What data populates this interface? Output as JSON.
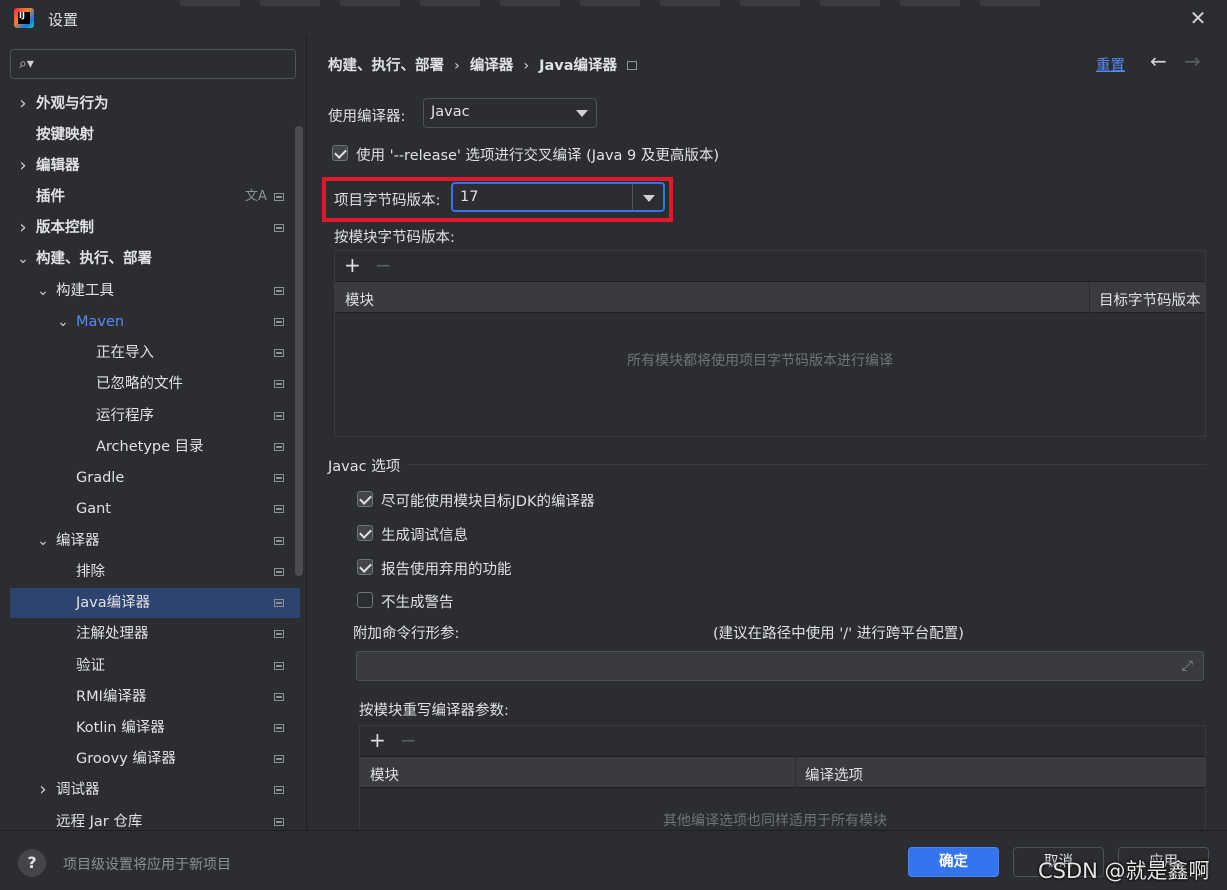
{
  "window": {
    "title": "设置",
    "app_icon_letters": "IJ",
    "close_icon": "close-icon"
  },
  "sidebar": {
    "search_placeholder": "",
    "items": [
      {
        "label": "外观与行为",
        "arrow": "›",
        "bold": true
      },
      {
        "label": "按键映射",
        "arrow": "",
        "bold": true
      },
      {
        "label": "编辑器",
        "arrow": "›",
        "bold": true
      },
      {
        "label": "插件",
        "arrow": "",
        "bold": true,
        "translate": "文A"
      },
      {
        "label": "版本控制",
        "arrow": "›",
        "bold": true
      },
      {
        "label": "构建、执行、部署",
        "arrow": "⌄",
        "bold": true
      },
      {
        "label": "构建工具",
        "arrow": "⌄"
      },
      {
        "label": "Maven",
        "arrow": "⌄"
      },
      {
        "label": "正在导入",
        "arrow": ""
      },
      {
        "label": "已忽略的文件",
        "arrow": ""
      },
      {
        "label": "运行程序",
        "arrow": ""
      },
      {
        "label": "Archetype 目录",
        "arrow": ""
      },
      {
        "label": "Gradle",
        "arrow": ""
      },
      {
        "label": "Gant",
        "arrow": ""
      },
      {
        "label": "编译器",
        "arrow": "⌄"
      },
      {
        "label": "排除",
        "arrow": ""
      },
      {
        "label": "Java编译器",
        "arrow": "",
        "selected": true
      },
      {
        "label": "注解处理器",
        "arrow": ""
      },
      {
        "label": "验证",
        "arrow": ""
      },
      {
        "label": "RMI编译器",
        "arrow": ""
      },
      {
        "label": "Kotlin 编译器",
        "arrow": ""
      },
      {
        "label": "Groovy 编译器",
        "arrow": ""
      },
      {
        "label": "调试器",
        "arrow": "›"
      },
      {
        "label": "远程 Jar 仓库",
        "arrow": ""
      }
    ]
  },
  "main": {
    "breadcrumb": [
      "构建、执行、部署",
      "编译器",
      "Java编译器"
    ],
    "breadcrumb_sep": "›",
    "reset_label": "重置",
    "back_icon": "←",
    "forward_icon": "→",
    "compiler_label": "使用编译器:",
    "compiler_value": "Javac",
    "release_option_label": "使用 '--release' 选项进行交叉编译 (Java 9 及更高版本)",
    "release_option_checked": true,
    "bytecode_label": "项目字节码版本:",
    "bytecode_value": "17",
    "per_module_bytecode_label": "按模块字节码版本:",
    "module_table": {
      "add": "+",
      "remove": "−",
      "columns": [
        "模块",
        "目标字节码版本"
      ],
      "empty_text": "所有模块都将使用项目字节码版本进行编译"
    },
    "javac_section_title": "Javac 选项",
    "javac_options": [
      {
        "label": "尽可能使用模块目标JDK的编译器",
        "checked": true
      },
      {
        "label": "生成调试信息",
        "checked": true
      },
      {
        "label": "报告使用弃用的功能",
        "checked": true
      },
      {
        "label": "不生成警告",
        "checked": false
      }
    ],
    "extra_args_label": "附加命令行形参:",
    "extra_args_hint": "(建议在路径中使用 '/' 进行跨平台配置)",
    "extra_args_value": "",
    "expand_icon": "⤢",
    "override_label": "按模块重写编译器参数:",
    "override_table": {
      "add": "+",
      "remove": "−",
      "columns": [
        "模块",
        "编译选项"
      ],
      "empty_text": "其他编译选项也同样适用于所有模块"
    }
  },
  "footer": {
    "help_icon": "?",
    "message": "项目级设置将应用于新项目",
    "ok_label": "确定",
    "cancel_label": "取消",
    "apply_label": "应用",
    "watermark": "CSDN @就是鑫啊"
  },
  "colors": {
    "accent": "#3574f0",
    "highlight_box": "#e0192a",
    "selected_row": "#2e436e",
    "link": "#548af7"
  }
}
